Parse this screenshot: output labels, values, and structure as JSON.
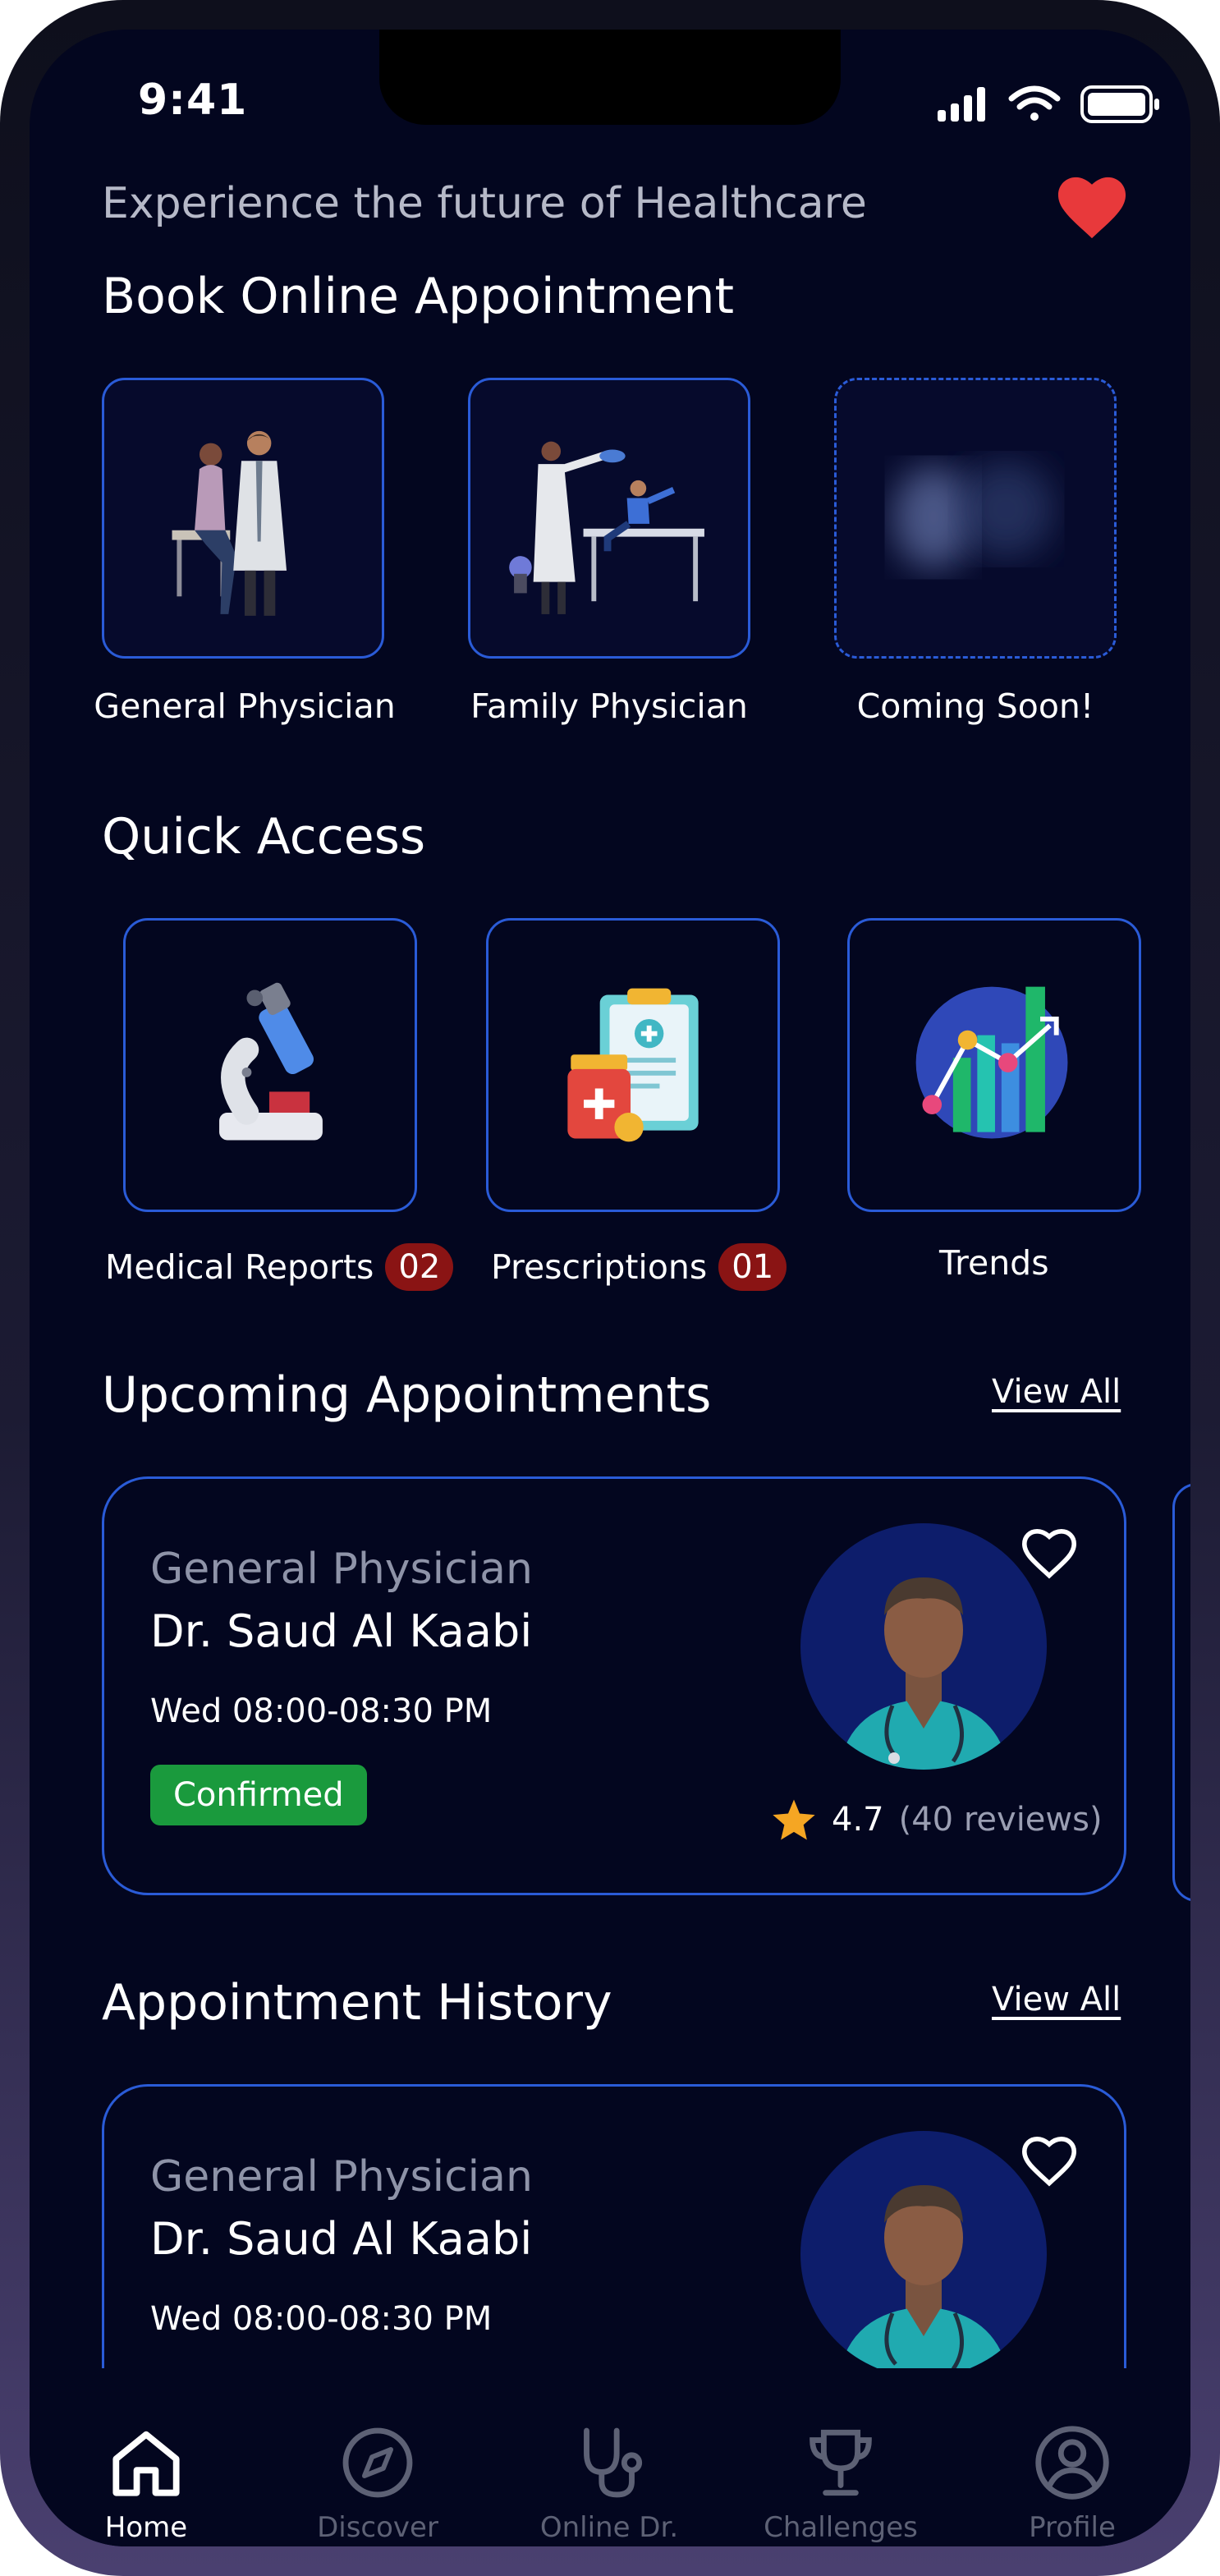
{
  "status_bar": {
    "time": "9:41"
  },
  "header": {
    "tagline": "Experience the future of Healthcare"
  },
  "book": {
    "title": "Book Online Appointment",
    "cards": [
      {
        "label": "General Physician"
      },
      {
        "label": "Family Physician"
      },
      {
        "label": "Coming Soon!"
      }
    ]
  },
  "quick_access": {
    "title": "Quick Access",
    "items": [
      {
        "label": "Medical Reports",
        "badge": "02"
      },
      {
        "label": "Prescriptions",
        "badge": "01"
      },
      {
        "label": "Trends"
      }
    ]
  },
  "upcoming": {
    "title": "Upcoming Appointments",
    "view_all": "View All",
    "card": {
      "specialty": "General Physician",
      "doctor": "Dr. Saud Al Kaabi",
      "time": "Wed 08:00-08:30 PM",
      "status": "Confirmed",
      "rating": "4.7",
      "reviews": "(40 reviews)"
    }
  },
  "history": {
    "title": "Appointment History",
    "view_all": "View All",
    "card": {
      "specialty": "General Physician",
      "doctor": "Dr. Saud Al Kaabi",
      "time": "Wed 08:00-08:30 PM"
    }
  },
  "tabbar": {
    "tabs": [
      {
        "label": "Home",
        "icon": "home-icon"
      },
      {
        "label": "Discover",
        "icon": "compass-icon"
      },
      {
        "label": "Online Dr.",
        "icon": "stethoscope-icon"
      },
      {
        "label": "Challenges",
        "icon": "trophy-icon"
      },
      {
        "label": "Profile",
        "icon": "profile-icon"
      }
    ]
  },
  "colors": {
    "accent": "#2a5bd7",
    "background": "#03061f",
    "confirmed": "#1a9a3d",
    "badge": "#8a1414",
    "heart": "#e8393b"
  }
}
